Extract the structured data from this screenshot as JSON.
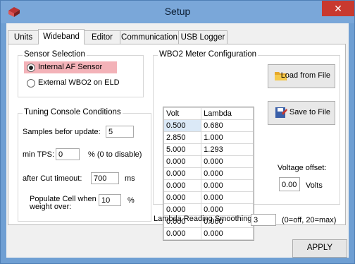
{
  "window": {
    "title": "Setup",
    "close_glyph": "✕",
    "app_icon": "cube-icon"
  },
  "tabs": [
    {
      "label": "Units"
    },
    {
      "label": "Wideband",
      "active": true
    },
    {
      "label": "Editor"
    },
    {
      "label": "Communication"
    },
    {
      "label": "USB Logger"
    }
  ],
  "sensor_selection": {
    "title": "Sensor Selection",
    "options": [
      {
        "label": "Internal AF Sensor",
        "selected": true
      },
      {
        "label": "External WBO2 on ELD",
        "selected": false
      }
    ]
  },
  "tuning": {
    "title": "Tuning Console  Conditions",
    "samples_label": "Samples befor update:",
    "samples_value": "5",
    "min_tps_label": "min TPS:",
    "min_tps_value": "0",
    "min_tps_hint": "% (0 to disable)",
    "cut_label": "after Cut timeout:",
    "cut_value": "700",
    "cut_unit": "ms",
    "populate_label_1": "Populate Cell when",
    "populate_label_2": "weight over:",
    "populate_value": "10",
    "populate_unit": "%"
  },
  "meter": {
    "title": "WBO2 Meter Configuration",
    "columns": [
      "Volt",
      "Lambda"
    ],
    "rows": [
      [
        "0.500",
        "0.680"
      ],
      [
        "2.850",
        "1.000"
      ],
      [
        "5.000",
        "1.293"
      ],
      [
        "0.000",
        "0.000"
      ],
      [
        "0.000",
        "0.000"
      ],
      [
        "0.000",
        "0.000"
      ],
      [
        "0.000",
        "0.000"
      ],
      [
        "0.000",
        "0.000"
      ],
      [
        "0.000",
        "0.000"
      ],
      [
        "0.000",
        "0.000"
      ]
    ],
    "load_label": "Load from File",
    "save_label": "Save to File",
    "voltage_offset_label": "Voltage offset:",
    "voltage_offset_value": "0.00",
    "voltage_offset_unit": "Volts"
  },
  "smoothing": {
    "label": "Lambda Reading Smoothing:",
    "value": "3",
    "hint": "(0=off, 20=max)"
  },
  "footer": {
    "apply_label": "APPLY"
  },
  "colors": {
    "titlebar": "#7aa7d9",
    "close": "#c8392f",
    "highlight": "#f3b2b8"
  }
}
